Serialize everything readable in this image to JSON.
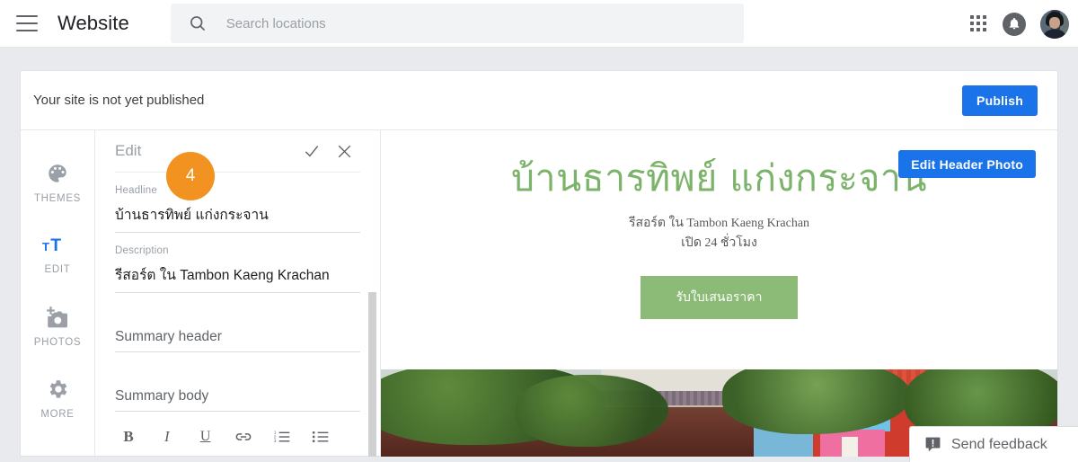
{
  "appbar": {
    "menu_icon": "hamburger-menu-icon",
    "title": "Website",
    "search": {
      "icon": "search-icon",
      "placeholder": "Search locations",
      "value": ""
    },
    "apps_icon": "apps-grid-icon",
    "notifications_icon": "bell-icon",
    "avatar": "user-avatar"
  },
  "publish_bar": {
    "message": "Your site is not yet published",
    "publish_label": "Publish",
    "publish_color": "#1a73e8"
  },
  "rail": {
    "items": [
      {
        "label": "THEMES",
        "icon": "palette-icon",
        "active": false
      },
      {
        "label": "EDIT",
        "icon": "text-size-icon",
        "active": true
      },
      {
        "label": "PHOTOS",
        "icon": "add-photo-icon",
        "active": false
      },
      {
        "label": "MORE",
        "icon": "gear-icon",
        "active": false
      }
    ],
    "active_color": "#1a73e8",
    "inactive_color": "#9aa0a6"
  },
  "panel": {
    "title": "Edit",
    "confirm_icon": "check-icon",
    "close_icon": "close-icon",
    "badge": "4",
    "badge_color": "#f29220",
    "fields": [
      {
        "label": "Headline",
        "value": "บ้านธารทิพย์ แก่งกระจาน"
      },
      {
        "label": "Description",
        "value": "รีสอร์ต ใน Tambon Kaeng Krachan"
      }
    ],
    "summary_header_placeholder": "Summary header",
    "summary_body_placeholder": "Summary body",
    "format_buttons": [
      {
        "name": "bold-button",
        "glyph": "B"
      },
      {
        "name": "italic-button",
        "glyph": "I"
      },
      {
        "name": "underline-button",
        "glyph": "U"
      },
      {
        "name": "link-button",
        "glyph": "link-icon"
      },
      {
        "name": "numbered-list-button",
        "glyph": "numbered-list-icon"
      },
      {
        "name": "bulleted-list-button",
        "glyph": "bulleted-list-icon"
      }
    ]
  },
  "preview": {
    "site_title": "บ้านธารทิพย์ แก่งกระจาน",
    "title_color": "#7cb36a",
    "subtitle_line1": "รีสอร์ต ใน Tambon Kaeng Krachan",
    "subtitle_line2": "เปิด 24 ชั่วโมง",
    "cta_label": "รับใบเสนอราคา",
    "cta_color": "#8bbb77",
    "edit_header_photo_label": "Edit Header Photo",
    "hero_alt": "resort-header-photo"
  },
  "feedback": {
    "label": "Send feedback",
    "icon": "feedback-icon"
  }
}
